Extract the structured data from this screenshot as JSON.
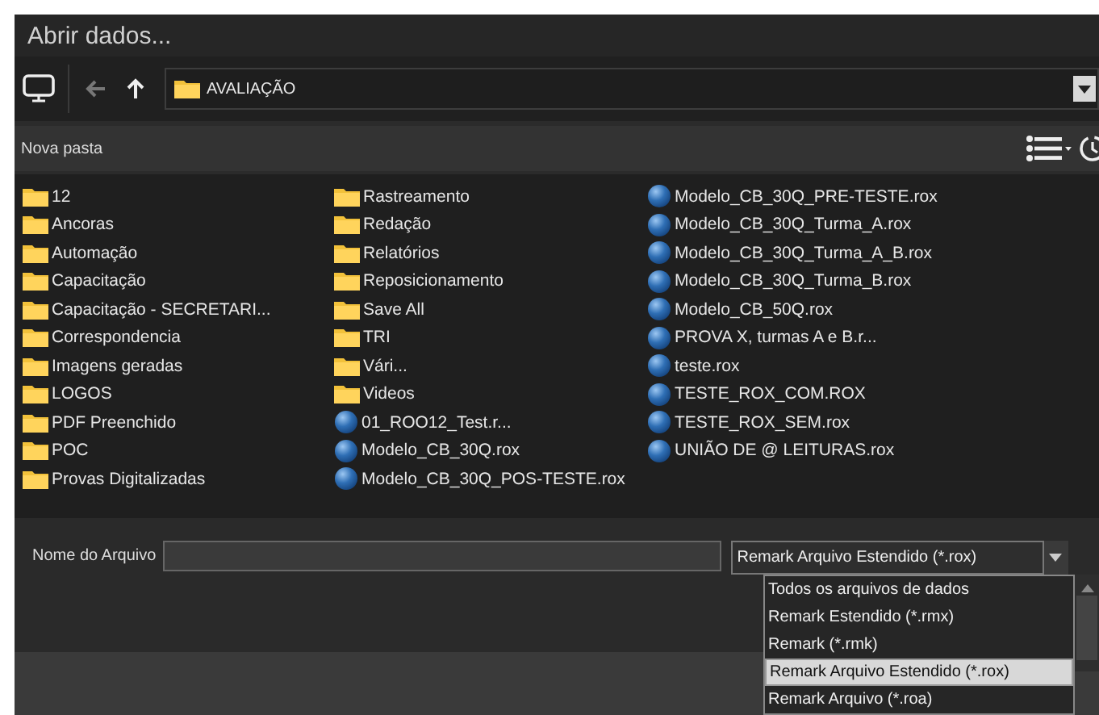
{
  "window": {
    "title": "Abrir dados..."
  },
  "toolbar": {
    "back_disabled": true,
    "path": "AVALIAÇÃO"
  },
  "command_bar": {
    "new_folder": "Nova pasta"
  },
  "items": [
    {
      "kind": "folder",
      "name": "12"
    },
    {
      "kind": "folder",
      "name": "Ancoras"
    },
    {
      "kind": "folder",
      "name": "Automação"
    },
    {
      "kind": "folder",
      "name": "Capacitação"
    },
    {
      "kind": "folder",
      "name": "Capacitação - SECRETARI..."
    },
    {
      "kind": "folder",
      "name": "Correspondencia"
    },
    {
      "kind": "folder",
      "name": "Imagens geradas"
    },
    {
      "kind": "folder",
      "name": "LOGOS"
    },
    {
      "kind": "folder",
      "name": "PDF Preenchido"
    },
    {
      "kind": "folder",
      "name": "POC"
    },
    {
      "kind": "folder",
      "name": "Provas Digitalizadas"
    },
    {
      "kind": "folder",
      "name": "Rastreamento"
    },
    {
      "kind": "folder",
      "name": "Redação"
    },
    {
      "kind": "folder",
      "name": "Relatórios"
    },
    {
      "kind": "folder",
      "name": "Reposicionamento"
    },
    {
      "kind": "folder",
      "name": "Save All"
    },
    {
      "kind": "folder",
      "name": "TRI"
    },
    {
      "kind": "folder",
      "name": "Vári..."
    },
    {
      "kind": "folder",
      "name": "Videos"
    },
    {
      "kind": "file",
      "name": "01_ROO12_Test.r..."
    },
    {
      "kind": "file",
      "name": "Modelo_CB_30Q.rox"
    },
    {
      "kind": "file",
      "name": "Modelo_CB_30Q_POS-TESTE.rox"
    },
    {
      "kind": "file",
      "name": "Modelo_CB_30Q_PRE-TESTE.rox"
    },
    {
      "kind": "file",
      "name": "Modelo_CB_30Q_Turma_A.rox"
    },
    {
      "kind": "file",
      "name": "Modelo_CB_30Q_Turma_A_B.rox"
    },
    {
      "kind": "file",
      "name": "Modelo_CB_30Q_Turma_B.rox"
    },
    {
      "kind": "file",
      "name": "Modelo_CB_50Q.rox"
    },
    {
      "kind": "file",
      "name": "PROVA X, turmas A e B.r..."
    },
    {
      "kind": "file",
      "name": "teste.rox"
    },
    {
      "kind": "file",
      "name": "TESTE_ROX_COM.ROX"
    },
    {
      "kind": "file",
      "name": "TESTE_ROX_SEM.rox"
    },
    {
      "kind": "file",
      "name": "UNIÃO DE @ LEITURAS.rox"
    }
  ],
  "file_name": {
    "label": "Nome do Arquivo"
  },
  "file_type": {
    "value": "Remark Arquivo Estendido (*.rox)",
    "expanded": true,
    "options": [
      {
        "label": "Todos os arquivos de dados",
        "selected": false
      },
      {
        "label": "Remark Estendido (*.rmx)",
        "selected": false
      },
      {
        "label": "Remark (*.rmk)",
        "selected": false
      },
      {
        "label": "Remark Arquivo Estendido (*.rox)",
        "selected": true
      },
      {
        "label": "Remark Arquivo (*.roa)",
        "selected": false
      }
    ]
  }
}
